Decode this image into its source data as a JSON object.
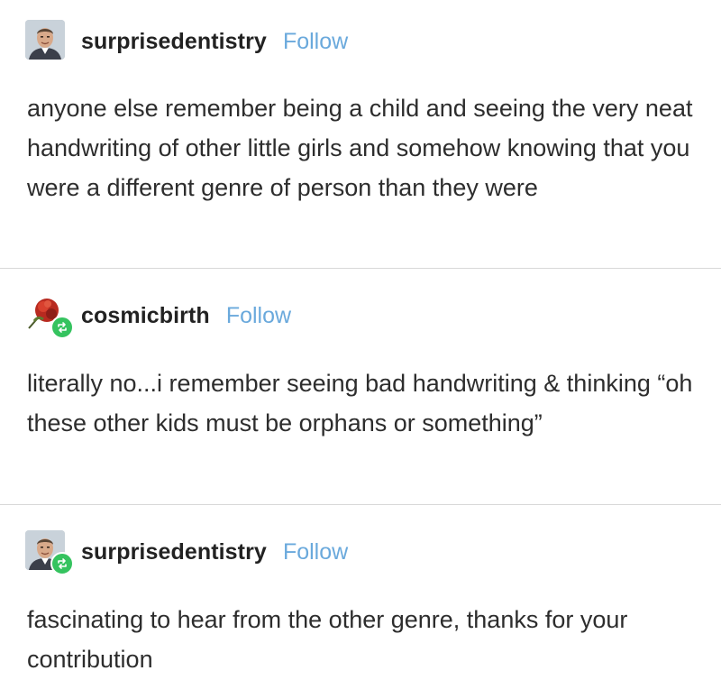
{
  "posts": [
    {
      "username": "surprisedentistry",
      "follow_label": "Follow",
      "avatar": "man-face-avatar",
      "reblogged": false,
      "text": "anyone else remember being a child and seeing the very neat handwriting of other little girls and somehow knowing that you were a different genre of person than they were"
    },
    {
      "username": "cosmicbirth",
      "follow_label": "Follow",
      "avatar": "red-flower-avatar",
      "reblogged": true,
      "text": "literally no...i remember seeing bad handwriting & thinking “oh these other kids must be orphans or something”"
    },
    {
      "username": "surprisedentistry",
      "follow_label": "Follow",
      "avatar": "man-face-avatar",
      "reblogged": true,
      "text": "fascinating to hear from the other genre, thanks for your contribution"
    }
  ],
  "colors": {
    "follow": "#6aa9dc",
    "reblog_badge": "#35c35f",
    "divider": "#d8d8d8",
    "text": "#2d2d2d"
  }
}
